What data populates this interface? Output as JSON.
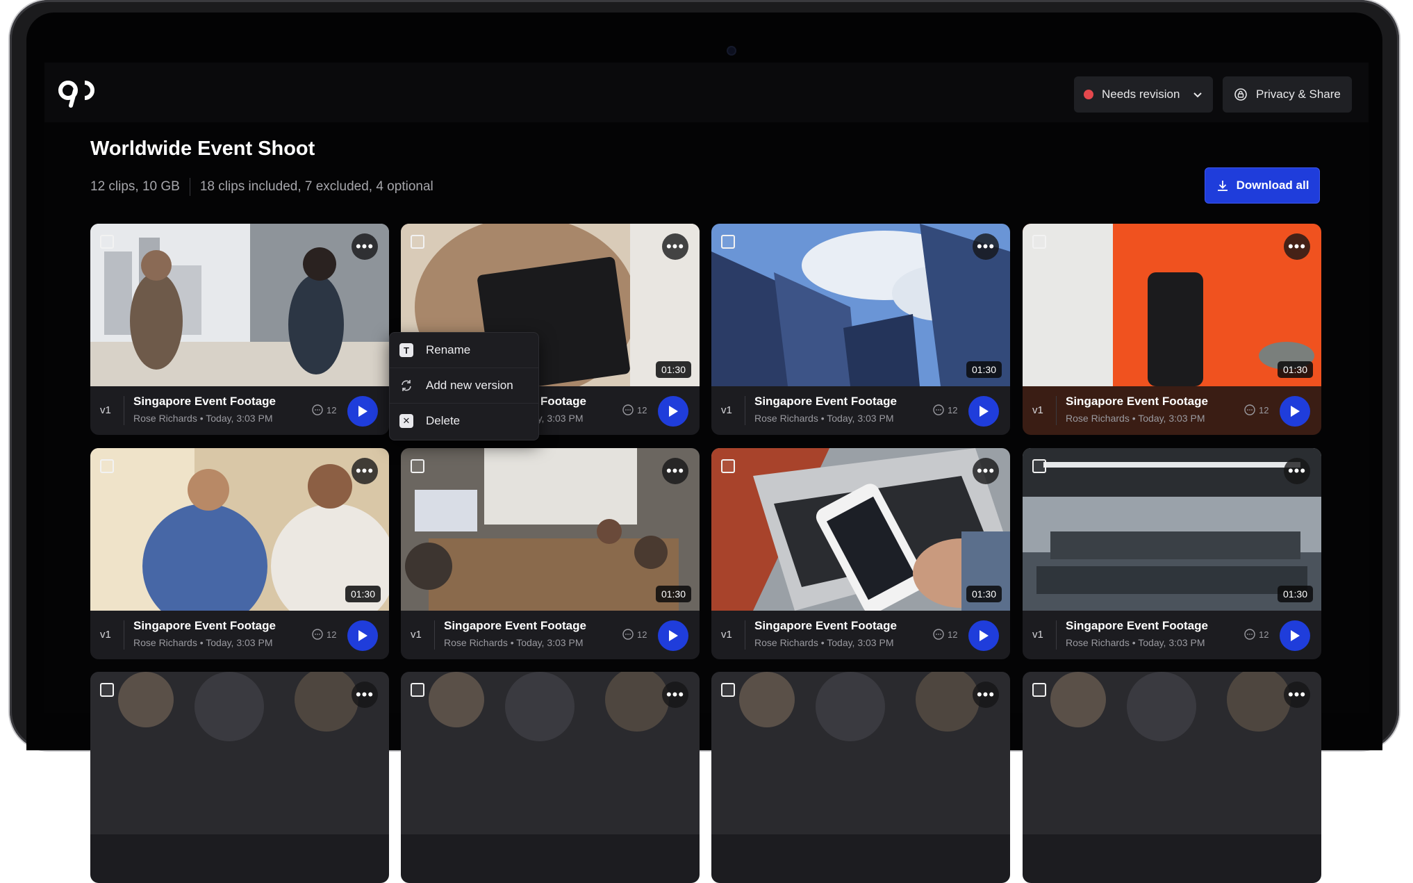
{
  "status": {
    "label": "Needs revision",
    "dot_color": "#e5484d"
  },
  "privacy": {
    "label": "Privacy & Share"
  },
  "page": {
    "title": "Worldwide Event Shoot",
    "size_summary": "12 clips, 10 GB",
    "clip_summary": "18 clips included, 7 excluded, 4 optional"
  },
  "download": {
    "label": "Download all"
  },
  "accent_color": "#1f3ddb",
  "clips": [
    {
      "version": "v1",
      "title": "Singapore Event Footage",
      "meta": "Rose Richards • Today, 3:03 PM",
      "comments": "12",
      "duration": ""
    },
    {
      "version": "v1",
      "title": "Singapore Event Footage",
      "meta": "Rose Richards • Today, 3:03 PM",
      "comments": "12",
      "duration": "01:30"
    },
    {
      "version": "v1",
      "title": "Singapore Event Footage",
      "meta": "Rose Richards • Today, 3:03 PM",
      "comments": "12",
      "duration": "01:30"
    },
    {
      "version": "v1",
      "title": "Singapore Event Footage",
      "meta": "Rose Richards • Today, 3:03 PM",
      "comments": "12",
      "duration": "01:30"
    },
    {
      "version": "v1",
      "title": "Singapore Event Footage",
      "meta": "Rose Richards • Today, 3:03 PM",
      "comments": "12",
      "duration": "01:30"
    },
    {
      "version": "v1",
      "title": "Singapore Event Footage",
      "meta": "Rose Richards • Today, 3:03 PM",
      "comments": "12",
      "duration": "01:30"
    },
    {
      "version": "v1",
      "title": "Singapore Event Footage",
      "meta": "Rose Richards • Today, 3:03 PM",
      "comments": "12",
      "duration": "01:30"
    },
    {
      "version": "v1",
      "title": "Singapore Event Footage",
      "meta": "Rose Richards • Today, 3:03 PM",
      "comments": "12",
      "duration": "01:30"
    }
  ],
  "context_menu": {
    "items": [
      {
        "label": "Rename",
        "icon": "text-icon"
      },
      {
        "label": "Add new version",
        "icon": "refresh-icon"
      },
      {
        "label": "Delete",
        "icon": "trash-icon"
      }
    ]
  }
}
